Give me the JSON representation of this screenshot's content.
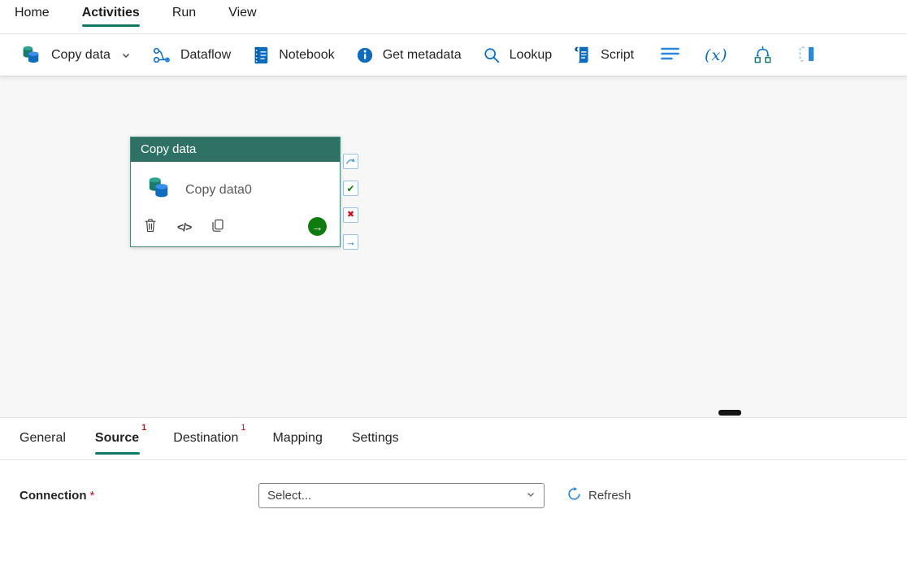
{
  "menu": {
    "tabs": [
      {
        "label": "Home",
        "selected": false
      },
      {
        "label": "Activities",
        "selected": true
      },
      {
        "label": "Run",
        "selected": false
      },
      {
        "label": "View",
        "selected": false
      }
    ]
  },
  "toolbar": {
    "items": [
      {
        "label": "Copy data",
        "icon": "copy-data-icon",
        "has_dropdown": true
      },
      {
        "label": "Dataflow",
        "icon": "dataflow-icon"
      },
      {
        "label": "Notebook",
        "icon": "notebook-icon"
      },
      {
        "label": "Get metadata",
        "icon": "info-icon"
      },
      {
        "label": "Lookup",
        "icon": "lookup-icon"
      },
      {
        "label": "Script",
        "icon": "script-icon"
      }
    ],
    "icon_only_items": [
      {
        "icon": "lines-icon"
      },
      {
        "icon": "set-variable-icon"
      },
      {
        "icon": "switch-icon"
      },
      {
        "icon": "frame-icon"
      }
    ]
  },
  "canvas": {
    "activity_card": {
      "header_label": "Copy data",
      "activity_name": "Copy data0"
    },
    "ports": [
      {
        "name": "on-skip",
        "icon": "curved-arrow-icon"
      },
      {
        "name": "on-success",
        "icon": "check-icon"
      },
      {
        "name": "on-fail",
        "icon": "cross-icon"
      },
      {
        "name": "on-completion",
        "icon": "arrow-right-icon"
      }
    ]
  },
  "panel": {
    "tabs": [
      {
        "label": "General",
        "badge": "",
        "selected": false
      },
      {
        "label": "Source",
        "badge": "1",
        "selected": true
      },
      {
        "label": "Destination",
        "badge": "1",
        "selected": false
      },
      {
        "label": "Mapping",
        "badge": "",
        "selected": false
      },
      {
        "label": "Settings",
        "badge": "",
        "selected": false
      }
    ],
    "connection": {
      "label": "Connection",
      "required": "*",
      "dropdown_value": "Select...",
      "refresh_label": "Refresh"
    }
  },
  "icons": {
    "code": "</>",
    "set_variable": "(x)",
    "check": "✔",
    "cross": "✖",
    "arrow_right": "→",
    "run_arrow": "→"
  },
  "colors": {
    "accent_teal": "#117865",
    "card_header": "#2f7164",
    "icon_blue": "#0f6cbd",
    "success_green": "#107c10",
    "fail_red": "#c50f1f",
    "port_border": "#9cc0e0"
  }
}
